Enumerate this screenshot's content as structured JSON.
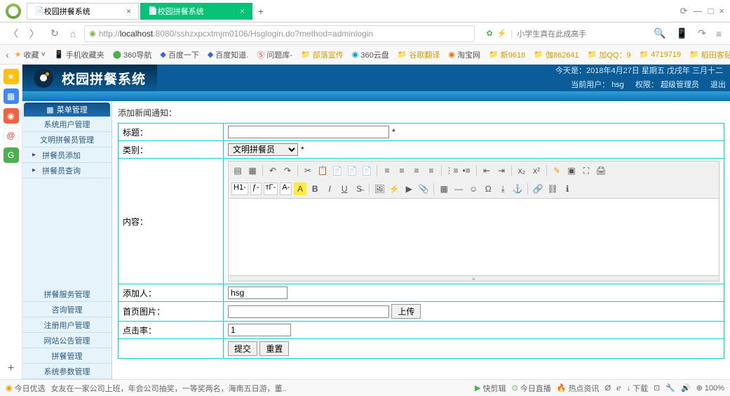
{
  "tabs": [
    {
      "label": "校园拼餐系统"
    },
    {
      "label": "校园拼餐系统"
    }
  ],
  "url_prefix": "http://",
  "url_host": "localhost",
  "url_rest": ":8080/sshzxpcxtmjm0106/Hsglogin.do?method=adminlogin",
  "nav_tagline": "小学生真在此成高手",
  "bookmarks": {
    "fav": "收藏",
    "items": [
      "手机收藏夹",
      "360导航",
      "百度一下",
      "百度知道.",
      "问题库-",
      "部落宣传",
      "360云盘",
      "谷歌翻译",
      "淘宝网",
      "新9618",
      "伽862641",
      "加QQ：9",
      "4719719",
      "稻田客贴"
    ]
  },
  "app": {
    "title": "校园拼餐系统",
    "date_info": "今天是：2018年4月27日 星期五 戊戌年 三月十二",
    "user_label": "当前用户：",
    "user": "hsg",
    "perm_label": "权限：",
    "perm": "超级管理员",
    "logout": "退出"
  },
  "sidebar": {
    "header": "菜单管理",
    "top_items": [
      "系统用户管理",
      "文明拼餐员管理",
      "拼餐员添加",
      "拼餐员查询"
    ],
    "bottom_items": [
      "拼餐服务管理",
      "咨询管理",
      "注册用户管理",
      "网站公告管理",
      "拼餐管理",
      "系统参数管理"
    ]
  },
  "panel": {
    "title_text": "添加新闻通知：",
    "labels": {
      "title": "标题：",
      "type": "类别：",
      "content": "内容：",
      "adder": "添加人：",
      "image": "首页图片：",
      "clicks": "点击率："
    },
    "type_value": "文明拼餐员",
    "adder_value": "hsg",
    "clicks_value": "1",
    "upload_btn": "上传",
    "submit": "提交",
    "reset": "重置",
    "asterisk": "*",
    "h_label": "H1-",
    "f_label": "ƒ-",
    "t_label": "тГ-",
    "a_label": "A-"
  },
  "bottom": {
    "today": "今日优选",
    "headlines": "女友在一家公司上班，年会公司抽奖，一等奖两名，海南五日游，董..",
    "kuaijianji": "快剪辑",
    "live": "今日直播",
    "news": "热点资讯",
    "download": "下载",
    "pip": "℮",
    "zoom": "100%"
  }
}
